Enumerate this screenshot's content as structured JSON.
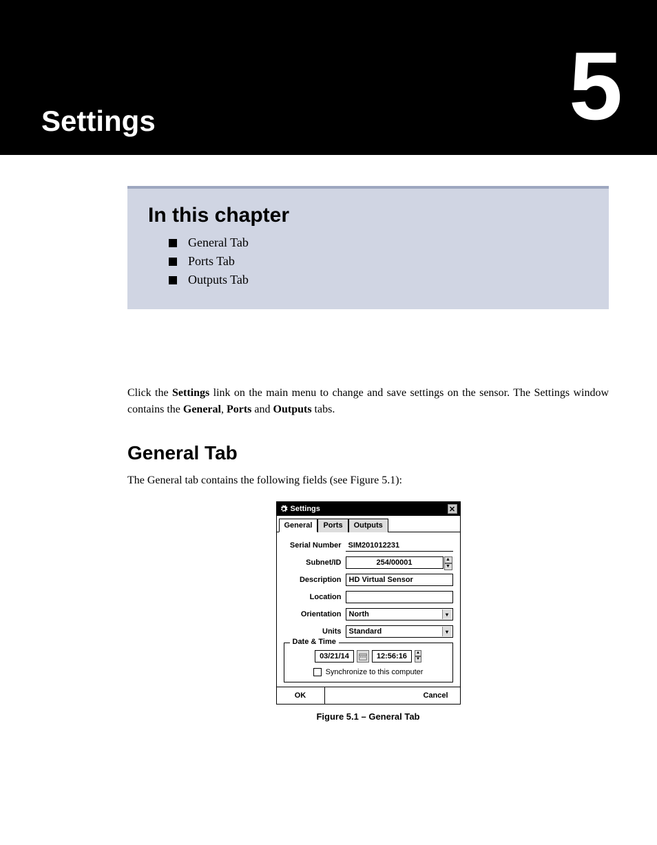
{
  "banner": {
    "title": "Settings",
    "number": "5"
  },
  "chapter_box": {
    "heading": "In this chapter",
    "items": [
      "General Tab",
      "Ports Tab",
      "Outputs Tab"
    ]
  },
  "intro": {
    "pre": "Click the ",
    "link": "Settings",
    "mid1": " link on the main menu to change and save settings on the sensor. The Settings window contains the ",
    "b1": "General",
    "sep1": ", ",
    "b2": "Ports",
    "sep2": " and ",
    "b3": "Outputs",
    "post": " tabs."
  },
  "section_heading": "General Tab",
  "section_text": "The General tab contains the following fields (see Figure 5.1):",
  "dialog": {
    "title": "Settings",
    "tabs": [
      "General",
      "Ports",
      "Outputs"
    ],
    "active_tab": 0,
    "fields": {
      "serial_label": "Serial Number",
      "serial_value": "SIM201012231",
      "subnet_label": "Subnet/ID",
      "subnet_value": "254/00001",
      "description_label": "Description",
      "description_value": "HD Virtual Sensor",
      "location_label": "Location",
      "location_value": "",
      "orientation_label": "Orientation",
      "orientation_value": "North",
      "units_label": "Units",
      "units_value": "Standard"
    },
    "datetime": {
      "group_label": "Date & Time",
      "date": "03/21/14",
      "time": "12:56:16",
      "sync_label": "Synchronize to this computer"
    },
    "buttons": {
      "ok": "OK",
      "cancel": "Cancel"
    }
  },
  "figure_caption": "Figure 5.1 – General Tab"
}
